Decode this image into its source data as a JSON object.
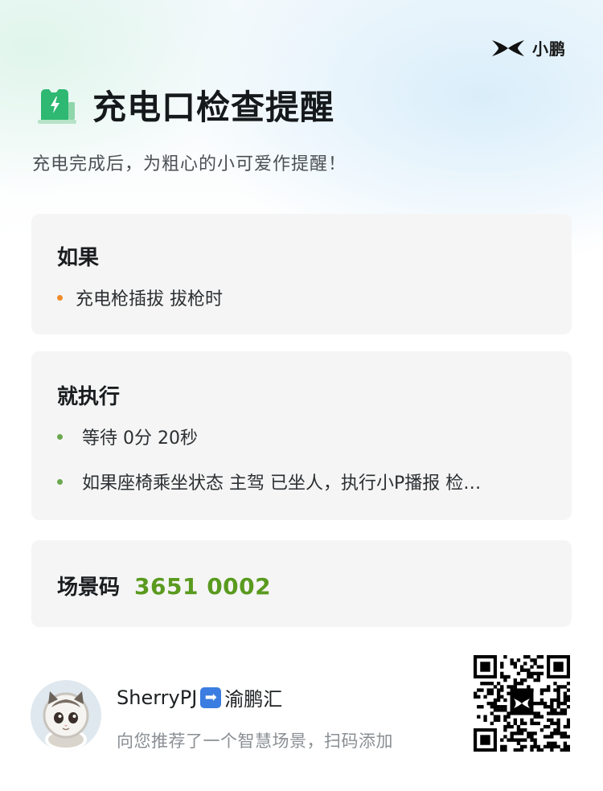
{
  "brand": {
    "label": "小鹏",
    "icon": "xpeng-logo-icon"
  },
  "header": {
    "icon": "charging-station-icon",
    "title": "充电口检查提醒",
    "subtitle": "充电完成后，为粗心的小可爱作提醒！"
  },
  "condition_card": {
    "heading": "如果",
    "items": [
      "充电枪插拔 拔枪时"
    ]
  },
  "action_card": {
    "heading": "就执行",
    "items": [
      "等待 0分 20秒",
      "如果座椅乘坐状态 主驾 已坐人，执行小P播报 检…"
    ]
  },
  "scene_code": {
    "label": "场景码",
    "value": "3651 0002"
  },
  "author": {
    "name_part1": "SherryPJ",
    "name_part2": "渝鹏汇",
    "description": "向您推荐了一个智慧场景，扫码添加"
  },
  "colors": {
    "accent_green": "#5a9a1f",
    "icon_green": "#2eb872",
    "bullet_orange": "#f08a2a",
    "bullet_green": "#6aa84f",
    "card_bg": "#f5f5f5"
  }
}
